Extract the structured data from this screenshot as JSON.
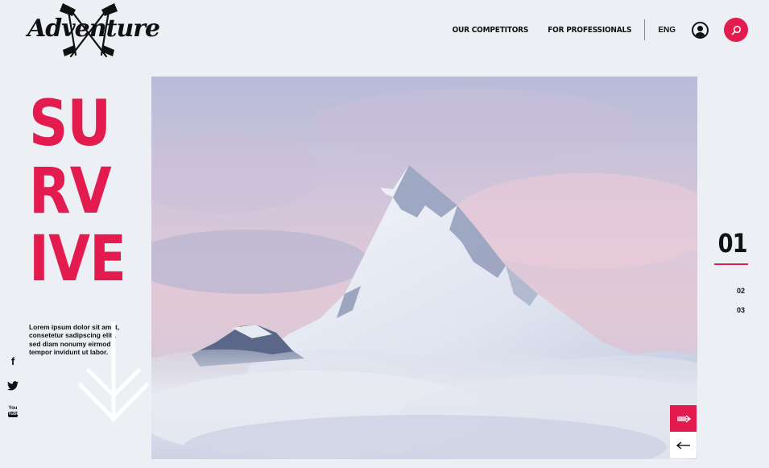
{
  "brand": {
    "logo_text": "Adventure",
    "accent_color": "#e31b4e"
  },
  "nav": {
    "links": [
      "OUR COMPETITORS",
      "FOR PROFESSIONALS"
    ],
    "language": "ENG",
    "user_icon": "user-icon",
    "search_icon": "search-icon"
  },
  "hero": {
    "word_lines": [
      "SU",
      "RV",
      "IVE"
    ],
    "intro": "Lorem ipsum dolor sit amet, consetetur sadipscing elitr, sed diam nonumy eirmod tempor invidunt ut labor.",
    "image_subject": "snow-capped-mountain"
  },
  "social": {
    "facebook": "f",
    "twitter_icon": "twitter-icon",
    "youtube_top": "You",
    "youtube_bottom": "Tube"
  },
  "pager": {
    "current": "01",
    "items": [
      "02",
      "03"
    ]
  },
  "slider": {
    "next_icon": "arrow-right-icon",
    "prev_icon": "arrow-left-icon"
  }
}
